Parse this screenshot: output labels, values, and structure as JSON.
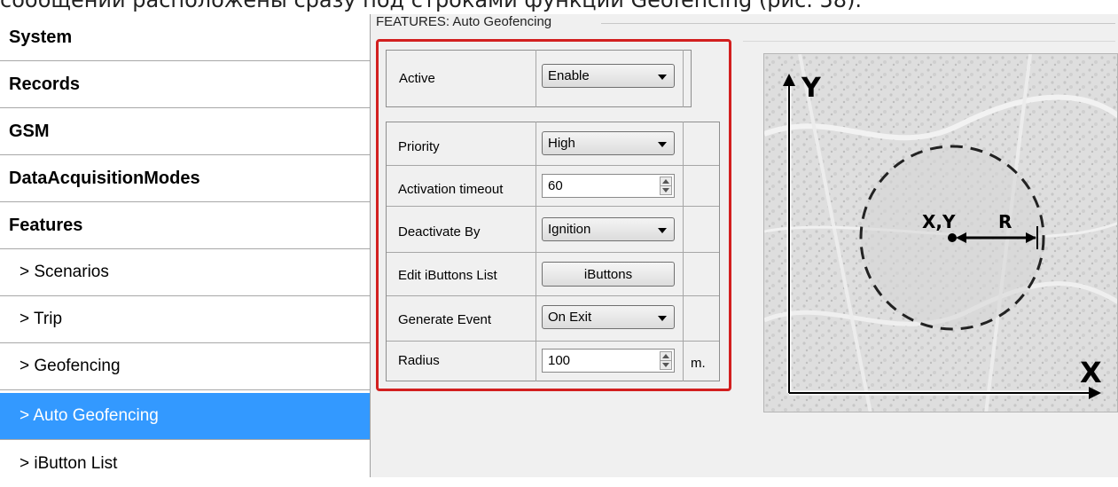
{
  "document_text": "сообщений расположены сразу под строками функции Geofencing (рис. 58).",
  "sidebar": {
    "items": [
      {
        "label": "System"
      },
      {
        "label": "Records"
      },
      {
        "label": "GSM"
      },
      {
        "label": "DataAcquisitionModes"
      },
      {
        "label": "Features"
      },
      {
        "label": "> Scenarios"
      },
      {
        "label": "> Trip"
      },
      {
        "label": "> Geofencing"
      },
      {
        "label": "> Auto Geofencing"
      },
      {
        "label": "> iButton List"
      }
    ]
  },
  "main": {
    "group_title": "FEATURES: Auto Geofencing",
    "active": {
      "label": "Active",
      "value": "Enable"
    },
    "priority": {
      "label": "Priority",
      "value": "High"
    },
    "activation_timeout": {
      "label": "Activation timeout",
      "value": "60"
    },
    "deactivate_by": {
      "label": "Deactivate By",
      "value": "Ignition"
    },
    "edit_ibuttons": {
      "label": "Edit iButtons List",
      "button": "iButtons"
    },
    "generate_event": {
      "label": "Generate Event",
      "value": "On Exit"
    },
    "radius": {
      "label": "Radius",
      "value": "100",
      "unit": "m."
    }
  },
  "diagram": {
    "y_axis": "Y",
    "x_axis": "X",
    "center": "X,Y",
    "radius": "R"
  },
  "colors": {
    "selected": "#3399ff",
    "highlight": "#d21f1f"
  }
}
